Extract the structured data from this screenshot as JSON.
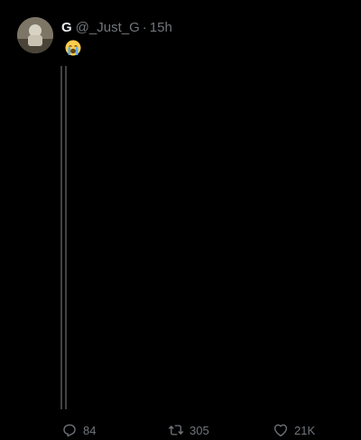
{
  "tweet": {
    "display_name": "G",
    "handle": "@_Just_G",
    "separator": "·",
    "time": "15h",
    "text": "",
    "emoji": "loudly-crying-face"
  },
  "icons": {
    "reply": "reply-icon",
    "retweet": "retweet-icon",
    "like": "like-icon"
  },
  "actions": {
    "reply_count": "84",
    "retweet_count": "305",
    "like_count": "21K"
  },
  "colors": {
    "background": "#000000",
    "text_primary": "#e7e9ea",
    "text_secondary": "#71767b",
    "thread_line": "#3f4347"
  }
}
